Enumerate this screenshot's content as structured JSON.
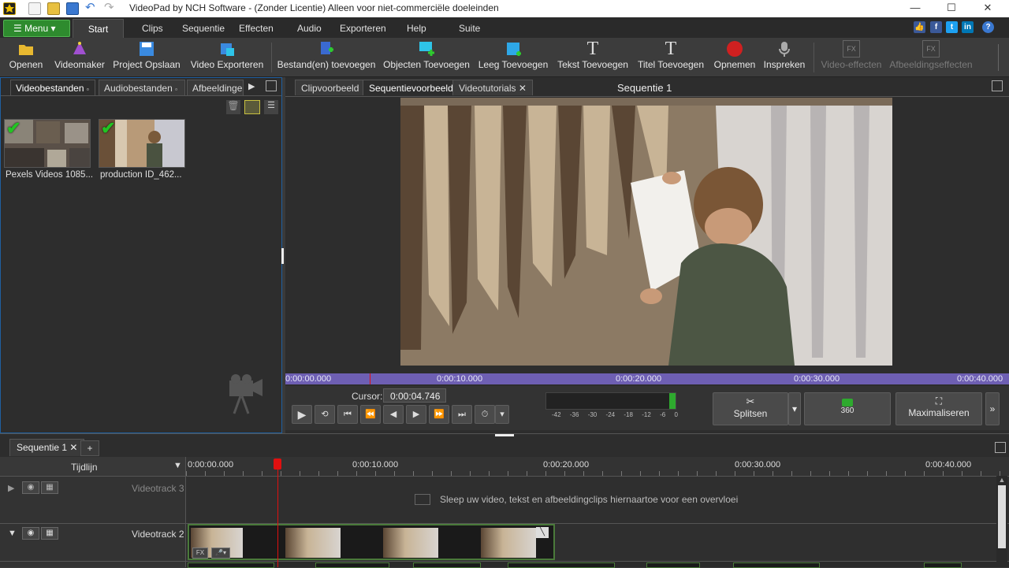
{
  "window": {
    "title": "VideoPad by NCH Software - (Zonder Licentie) Alleen voor niet-commerciële doeleinden"
  },
  "menubar": {
    "menu_label": "Menu",
    "tabs": [
      "Start",
      "Clips",
      "Sequentie",
      "Effecten",
      "Audio",
      "Exporteren",
      "Help",
      "Suite"
    ]
  },
  "toolbar": {
    "open": "Openen",
    "videomaker": "Videomaker",
    "save_project": "Project Opslaan",
    "export_video": "Video Exporteren",
    "add_files": "Bestand(en) toevoegen",
    "add_objects": "Objecten Toevoegen",
    "add_empty": "Leeg Toevoegen",
    "add_text": "Tekst Toevoegen",
    "add_title": "Titel Toevoegen",
    "record": "Opnemen",
    "narrate": "Inspreken",
    "video_effects": "Video-effecten",
    "image_effects": "Afbeeldingseffecten"
  },
  "leftpanel": {
    "tabs": [
      "Videobestanden",
      "Audiobestanden",
      "Afbeeldinge"
    ],
    "files": [
      {
        "name": "Pexels Videos 1085..."
      },
      {
        "name": "production ID_462..."
      }
    ]
  },
  "preview": {
    "tabs": [
      "Clipvoorbeeld",
      "Sequentievoorbeeld",
      "Videotutorials"
    ],
    "title": "Sequentie 1",
    "ruler": [
      "0:00:00.000",
      "0:00:10.000",
      "0:00:20.000",
      "0:00:30.000",
      "0:00:40.000"
    ],
    "cursor_label": "Cursor:",
    "cursor_value": "0:00:04.746",
    "meter_scale": [
      "-42",
      "-36",
      "-30",
      "-24",
      "-18",
      "-12",
      "-6",
      "0"
    ],
    "split": "Splitsen",
    "vr": "360",
    "maximize": "Maximaliseren"
  },
  "sequence": {
    "tab": "Sequentie 1",
    "add": "+",
    "timeline_label": "Tijdlijn",
    "ruler": [
      "0:00:00.000",
      "0:00:10.000",
      "0:00:20.000",
      "0:00:30.000",
      "0:00:40.000"
    ],
    "track3": "Videotrack 3",
    "track2": "Videotrack 2",
    "drop_hint": "Sleep uw video, tekst en afbeeldingclips hiernaartoe voor een overvloei"
  },
  "colors": {
    "accent_green": "#2e8b2e",
    "ruler_purple": "#6e5fb3",
    "playhead": "#e01010"
  }
}
